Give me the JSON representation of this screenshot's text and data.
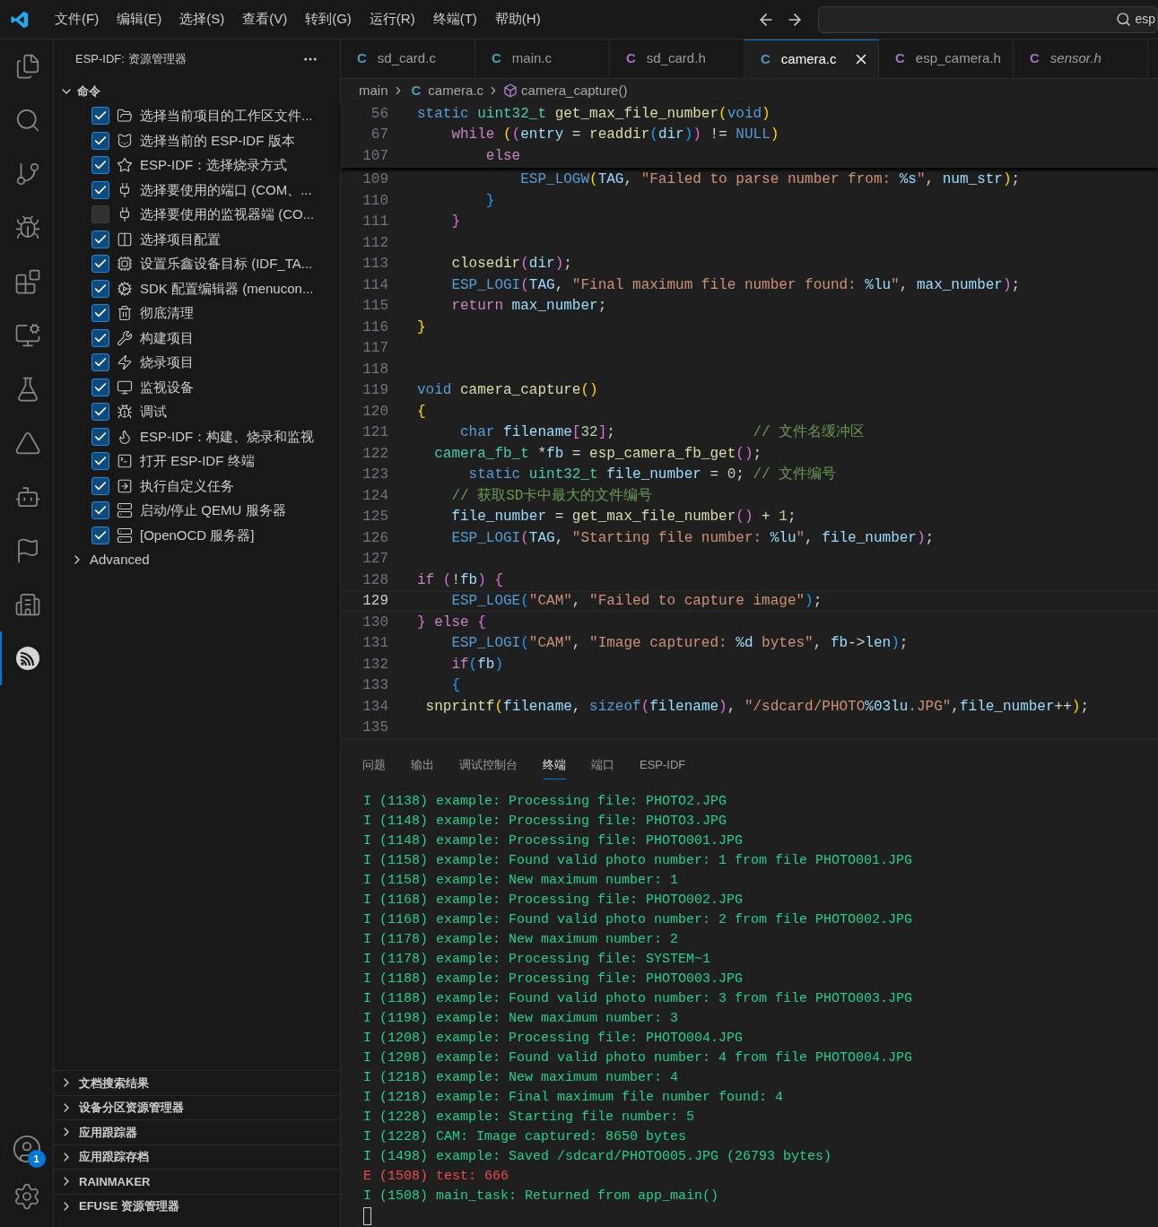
{
  "menu": [
    "文件(F)",
    "编辑(E)",
    "选择(S)",
    "查看(V)",
    "转到(G)",
    "运行(R)",
    "终端(T)",
    "帮助(H)"
  ],
  "search": {
    "value": "esp"
  },
  "activity_bar": {
    "items": [
      {
        "selected": false
      },
      {
        "selected": false
      },
      {
        "selected": false
      },
      {
        "selected": false
      },
      {
        "selected": false
      },
      {
        "selected": false
      },
      {
        "selected": false
      },
      {
        "selected": false
      },
      {
        "selected": false
      },
      {
        "selected": false
      },
      {
        "selected": false
      },
      {
        "selected": true
      }
    ],
    "account_badge": "1"
  },
  "sidebar": {
    "title": "ESP-IDF: 资源管理器",
    "tree": [
      {
        "label": "命令",
        "expanded": true,
        "children": [
          {
            "label": "选择当前项目的工作区文件...",
            "checked": true
          },
          {
            "label": "选择当前的 ESP-IDF 版本",
            "checked": true
          },
          {
            "label": "ESP-IDF：选择烧录方式",
            "checked": true
          },
          {
            "label": "选择要使用的端口 (COM、...",
            "checked": true
          },
          {
            "label": "选择要使用的监视器端 (CO...",
            "checked": false
          },
          {
            "label": "选择项目配置",
            "checked": true
          },
          {
            "label": "设置乐鑫设备目标 (IDF_TA...",
            "checked": true
          },
          {
            "label": "SDK 配置编辑器 (menucon...",
            "checked": true
          },
          {
            "label": "彻底清理",
            "checked": true
          },
          {
            "label": "构建项目",
            "checked": true
          },
          {
            "label": "烧录项目",
            "checked": true
          },
          {
            "label": "监视设备",
            "checked": true
          },
          {
            "label": "调试",
            "checked": true
          },
          {
            "label": "ESP-IDF：构建、烧录和监视",
            "checked": true
          },
          {
            "label": "打开 ESP-IDF 终端",
            "checked": true
          },
          {
            "label": "执行自定义任务",
            "checked": true
          },
          {
            "label": "启动/停止 QEMU 服务器",
            "checked": true
          },
          {
            "label": "[OpenOCD 服务器]",
            "checked": true
          }
        ]
      },
      {
        "label": "Advanced",
        "expanded": false
      }
    ],
    "sections": [
      {
        "label": "文档搜索结果",
        "expanded": false
      },
      {
        "label": "设备分区资源管理器",
        "expanded": false
      },
      {
        "label": "应用跟踪器",
        "expanded": false
      },
      {
        "label": "应用跟踪存档",
        "expanded": false
      },
      {
        "label": "RAINMAKER",
        "expanded": false
      },
      {
        "label": "EFUSE 资源管理器",
        "expanded": false
      }
    ]
  },
  "editor": {
    "tabs": [
      {
        "icon_text": "C",
        "color": "#519aba",
        "label": "sd_card.c",
        "selected": false,
        "preview": false
      },
      {
        "icon_text": "C",
        "color": "#519aba",
        "label": "main.c",
        "selected": false,
        "preview": false
      },
      {
        "icon_text": "C",
        "color": "#a074c4",
        "label": "sd_card.h",
        "selected": false,
        "preview": false
      },
      {
        "icon_text": "C",
        "color": "#519aba",
        "label": "camera.c",
        "selected": true,
        "preview": false
      },
      {
        "icon_text": "C",
        "color": "#a074c4",
        "label": "esp_camera.h",
        "selected": false,
        "preview": false
      },
      {
        "icon_text": "C",
        "color": "#a074c4",
        "label": "sensor.h",
        "selected": false,
        "preview": true
      }
    ],
    "breadcrumb": [
      {
        "label": "main"
      },
      {
        "label": "camera.c",
        "icon_text": "C"
      },
      {
        "label": "camera_capture()"
      }
    ],
    "sticky_lines": [
      {
        "number": "56",
        "tokens": [
          {
            "text": "static",
            "kind": "storage"
          },
          {
            "text": " uint32_t",
            "kind": "type"
          },
          {
            "text": " get_max_file_number",
            "kind": "fn"
          },
          {
            "text": "(",
            "kind": "b1"
          },
          {
            "text": "void",
            "kind": "storage"
          },
          {
            "text": ")",
            "kind": "b1"
          }
        ]
      },
      {
        "number": "67",
        "tokens": [
          {
            "text": "    while",
            "kind": "kw"
          },
          {
            "text": " (",
            "kind": "b1"
          },
          {
            "text": "(",
            "kind": "b2"
          },
          {
            "text": "entry",
            "kind": "var"
          },
          {
            "text": " = ",
            "kind": "p"
          },
          {
            "text": "readdir",
            "kind": "fn"
          },
          {
            "text": "(",
            "kind": "b3"
          },
          {
            "text": "dir",
            "kind": "var"
          },
          {
            "text": ")",
            "kind": "b3"
          },
          {
            "text": ")",
            "kind": "b2"
          },
          {
            "text": " != ",
            "kind": "p"
          },
          {
            "text": "NULL",
            "kind": "macro"
          },
          {
            "text": ")",
            "kind": "b1"
          }
        ]
      },
      {
        "number": "107",
        "tokens": [
          {
            "text": "        else",
            "kind": "kw"
          }
        ]
      }
    ],
    "lines": [
      {
        "number": "109",
        "current": false,
        "tokens": [
          {
            "text": "            ESP_LOGW",
            "kind": "macro"
          },
          {
            "text": "(",
            "kind": "b1"
          },
          {
            "text": "TAG",
            "kind": "var"
          },
          {
            "text": ", ",
            "kind": "p"
          },
          {
            "text": "\"Failed to parse number from: ",
            "kind": "str"
          },
          {
            "text": "%s",
            "kind": "fmt"
          },
          {
            "text": "\"",
            "kind": "str"
          },
          {
            "text": ", ",
            "kind": "p"
          },
          {
            "text": "num_str",
            "kind": "var"
          },
          {
            "text": ")",
            "kind": "b1"
          },
          {
            "text": ";",
            "kind": "p"
          }
        ]
      },
      {
        "number": "110",
        "current": false,
        "tokens": [
          {
            "text": "        }",
            "kind": "b3"
          }
        ]
      },
      {
        "number": "111",
        "current": false,
        "tokens": [
          {
            "text": "    }",
            "kind": "b2"
          }
        ]
      },
      {
        "number": "112",
        "current": false
      },
      {
        "number": "113",
        "current": false,
        "tokens": [
          {
            "text": "    closedir",
            "kind": "fn"
          },
          {
            "text": "(",
            "kind": "b2"
          },
          {
            "text": "dir",
            "kind": "var"
          },
          {
            "text": ")",
            "kind": "b2"
          },
          {
            "text": ";",
            "kind": "p"
          }
        ]
      },
      {
        "number": "114",
        "current": false,
        "tokens": [
          {
            "text": "    ESP_LOGI",
            "kind": "macro"
          },
          {
            "text": "(",
            "kind": "b2"
          },
          {
            "text": "TAG",
            "kind": "var"
          },
          {
            "text": ", ",
            "kind": "p"
          },
          {
            "text": "\"Final maximum file number found: ",
            "kind": "str"
          },
          {
            "text": "%lu",
            "kind": "fmt"
          },
          {
            "text": "\"",
            "kind": "str"
          },
          {
            "text": ", ",
            "kind": "p"
          },
          {
            "text": "max_number",
            "kind": "var"
          },
          {
            "text": ")",
            "kind": "b2"
          },
          {
            "text": ";",
            "kind": "p"
          }
        ]
      },
      {
        "number": "115",
        "current": false,
        "tokens": [
          {
            "text": "    return",
            "kind": "kw"
          },
          {
            "text": " max_number",
            "kind": "var"
          },
          {
            "text": ";",
            "kind": "p"
          }
        ]
      },
      {
        "number": "116",
        "current": false,
        "tokens": [
          {
            "text": "}",
            "kind": "b1"
          }
        ]
      },
      {
        "number": "117",
        "current": false
      },
      {
        "number": "118",
        "current": false
      },
      {
        "number": "119",
        "current": false,
        "tokens": [
          {
            "text": "void",
            "kind": "storage"
          },
          {
            "text": " camera_capture",
            "kind": "fn"
          },
          {
            "text": "()",
            "kind": "b1"
          }
        ]
      },
      {
        "number": "120",
        "current": false,
        "tokens": [
          {
            "text": "{",
            "kind": "b1"
          }
        ]
      },
      {
        "number": "121",
        "current": false,
        "tokens": [
          {
            "text": "     char",
            "kind": "storage"
          },
          {
            "text": " filename",
            "kind": "var"
          },
          {
            "text": "[",
            "kind": "b2"
          },
          {
            "text": "32",
            "kind": "num"
          },
          {
            "text": "]",
            "kind": "b2"
          },
          {
            "text": ";",
            "kind": "p"
          },
          {
            "text": "                // 文件名缓冲区",
            "kind": "comment"
          }
        ]
      },
      {
        "number": "122",
        "current": false,
        "tokens": [
          {
            "text": "  camera_fb_t",
            "kind": "type"
          },
          {
            "text": " *",
            "kind": "p"
          },
          {
            "text": "fb",
            "kind": "var"
          },
          {
            "text": " = ",
            "kind": "p"
          },
          {
            "text": "esp_camera_fb_get",
            "kind": "fn"
          },
          {
            "text": "()",
            "kind": "b2"
          },
          {
            "text": ";",
            "kind": "p"
          }
        ]
      },
      {
        "number": "123",
        "current": false,
        "tokens": [
          {
            "text": "      static",
            "kind": "storage"
          },
          {
            "text": " uint32_t",
            "kind": "type"
          },
          {
            "text": " file_number",
            "kind": "var"
          },
          {
            "text": " = ",
            "kind": "p"
          },
          {
            "text": "0",
            "kind": "num"
          },
          {
            "text": "; ",
            "kind": "p"
          },
          {
            "text": "// 文件编号",
            "kind": "comment"
          }
        ]
      },
      {
        "number": "124",
        "current": false,
        "tokens": [
          {
            "text": "    // 获取SD卡中最大的文件编号",
            "kind": "comment"
          }
        ]
      },
      {
        "number": "125",
        "current": false,
        "tokens": [
          {
            "text": "    file_number",
            "kind": "var"
          },
          {
            "text": " = ",
            "kind": "p"
          },
          {
            "text": "get_max_file_number",
            "kind": "fn"
          },
          {
            "text": "()",
            "kind": "b2"
          },
          {
            "text": " + ",
            "kind": "p"
          },
          {
            "text": "1",
            "kind": "num"
          },
          {
            "text": ";",
            "kind": "p"
          }
        ]
      },
      {
        "number": "126",
        "current": false,
        "tokens": [
          {
            "text": "    ESP_LOGI",
            "kind": "macro"
          },
          {
            "text": "(",
            "kind": "b2"
          },
          {
            "text": "TAG",
            "kind": "var"
          },
          {
            "text": ", ",
            "kind": "p"
          },
          {
            "text": "\"Starting file number: ",
            "kind": "str"
          },
          {
            "text": "%lu",
            "kind": "fmt"
          },
          {
            "text": "\"",
            "kind": "str"
          },
          {
            "text": ", ",
            "kind": "p"
          },
          {
            "text": "file_number",
            "kind": "var"
          },
          {
            "text": ")",
            "kind": "b2"
          },
          {
            "text": ";",
            "kind": "p"
          }
        ]
      },
      {
        "number": "127",
        "current": false
      },
      {
        "number": "128",
        "current": false,
        "tokens": [
          {
            "text": "if",
            "kind": "kw"
          },
          {
            "text": " (",
            "kind": "b2"
          },
          {
            "text": "!",
            "kind": "p"
          },
          {
            "text": "fb",
            "kind": "var"
          },
          {
            "text": ")",
            "kind": "b2"
          },
          {
            "text": " {",
            "kind": "b2"
          }
        ]
      },
      {
        "number": "129",
        "current": true,
        "tokens": [
          {
            "text": "    ESP_LOGE",
            "kind": "macro"
          },
          {
            "text": "(",
            "kind": "b3"
          },
          {
            "text": "\"CAM\"",
            "kind": "str"
          },
          {
            "text": ", ",
            "kind": "p"
          },
          {
            "text": "\"Failed to capture image\"",
            "kind": "str"
          },
          {
            "text": ")",
            "kind": "b3"
          },
          {
            "text": ";",
            "kind": "p"
          }
        ]
      },
      {
        "number": "130",
        "current": false,
        "tokens": [
          {
            "text": "}",
            "kind": "b2"
          },
          {
            "text": " else",
            "kind": "kw"
          },
          {
            "text": " {",
            "kind": "b2"
          }
        ]
      },
      {
        "number": "131",
        "current": false,
        "tokens": [
          {
            "text": "    ESP_LOGI",
            "kind": "macro"
          },
          {
            "text": "(",
            "kind": "b3"
          },
          {
            "text": "\"CAM\"",
            "kind": "str"
          },
          {
            "text": ", ",
            "kind": "p"
          },
          {
            "text": "\"Image captured: ",
            "kind": "str"
          },
          {
            "text": "%d",
            "kind": "fmt"
          },
          {
            "text": " bytes\"",
            "kind": "str"
          },
          {
            "text": ", ",
            "kind": "p"
          },
          {
            "text": "fb",
            "kind": "var"
          },
          {
            "text": "->",
            "kind": "p"
          },
          {
            "text": "len",
            "kind": "var"
          },
          {
            "text": ")",
            "kind": "b3"
          },
          {
            "text": ";",
            "kind": "p"
          }
        ]
      },
      {
        "number": "132",
        "current": false,
        "tokens": [
          {
            "text": "    if",
            "kind": "kw"
          },
          {
            "text": "(",
            "kind": "b3"
          },
          {
            "text": "fb",
            "kind": "var"
          },
          {
            "text": ")",
            "kind": "b3"
          }
        ]
      },
      {
        "number": "133",
        "current": false,
        "tokens": [
          {
            "text": "    {",
            "kind": "b3"
          }
        ]
      },
      {
        "number": "134",
        "current": false,
        "tokens": [
          {
            "text": " snprintf",
            "kind": "fn"
          },
          {
            "text": "(",
            "kind": "b1"
          },
          {
            "text": "filename",
            "kind": "var"
          },
          {
            "text": ", ",
            "kind": "p"
          },
          {
            "text": "sizeof",
            "kind": "storage"
          },
          {
            "text": "(",
            "kind": "b2"
          },
          {
            "text": "filename",
            "kind": "var"
          },
          {
            "text": ")",
            "kind": "b2"
          },
          {
            "text": ", ",
            "kind": "p"
          },
          {
            "text": "\"/sdcard/PHOTO",
            "kind": "str"
          },
          {
            "text": "%03lu",
            "kind": "fmt"
          },
          {
            "text": ".JPG\"",
            "kind": "str"
          },
          {
            "text": ",",
            "kind": "p"
          },
          {
            "text": "file_number",
            "kind": "var"
          },
          {
            "text": "++",
            "kind": "p"
          },
          {
            "text": ")",
            "kind": "b1"
          },
          {
            "text": ";",
            "kind": "p"
          }
        ]
      },
      {
        "number": "135",
        "current": false
      }
    ]
  },
  "panel": {
    "tabs": [
      {
        "label": "问题",
        "selected": false
      },
      {
        "label": "输出",
        "selected": false
      },
      {
        "label": "调试控制台",
        "selected": false
      },
      {
        "label": "终端",
        "selected": true
      },
      {
        "label": "端口",
        "selected": false
      },
      {
        "label": "ESP-IDF",
        "selected": false
      }
    ],
    "terminal": [
      {
        "kind": "info",
        "text": "I (1138) example: Processing file: PHOTO2.JPG"
      },
      {
        "kind": "info",
        "text": "I (1148) example: Processing file: PHOTO3.JPG"
      },
      {
        "kind": "info",
        "text": "I (1148) example: Processing file: PHOTO001.JPG"
      },
      {
        "kind": "info",
        "text": "I (1158) example: Found valid photo number: 1 from file PHOTO001.JPG"
      },
      {
        "kind": "info",
        "text": "I (1158) example: New maximum number: 1"
      },
      {
        "kind": "info",
        "text": "I (1168) example: Processing file: PHOTO002.JPG"
      },
      {
        "kind": "info",
        "text": "I (1168) example: Found valid photo number: 2 from file PHOTO002.JPG"
      },
      {
        "kind": "info",
        "text": "I (1178) example: New maximum number: 2"
      },
      {
        "kind": "info",
        "text": "I (1178) example: Processing file: SYSTEM~1"
      },
      {
        "kind": "info",
        "text": "I (1188) example: Processing file: PHOTO003.JPG"
      },
      {
        "kind": "info",
        "text": "I (1188) example: Found valid photo number: 3 from file PHOTO003.JPG"
      },
      {
        "kind": "info",
        "text": "I (1198) example: New maximum number: 3"
      },
      {
        "kind": "info",
        "text": "I (1208) example: Processing file: PHOTO004.JPG"
      },
      {
        "kind": "info",
        "text": "I (1208) example: Found valid photo number: 4 from file PHOTO004.JPG"
      },
      {
        "kind": "info",
        "text": "I (1218) example: New maximum number: 4"
      },
      {
        "kind": "info",
        "text": "I (1218) example: Final maximum file number found: 4"
      },
      {
        "kind": "info",
        "text": "I (1228) example: Starting file number: 5"
      },
      {
        "kind": "info",
        "text": "I (1228) CAM: Image captured: 8650 bytes"
      },
      {
        "kind": "info",
        "text": "I (1498) example: Saved /sdcard/PHOTO005.JPG (26793 bytes)"
      },
      {
        "kind": "error",
        "text": "E (1508) test: 666"
      },
      {
        "kind": "info",
        "text": "I (1508) main_task: Returned from app_main()"
      }
    ]
  }
}
